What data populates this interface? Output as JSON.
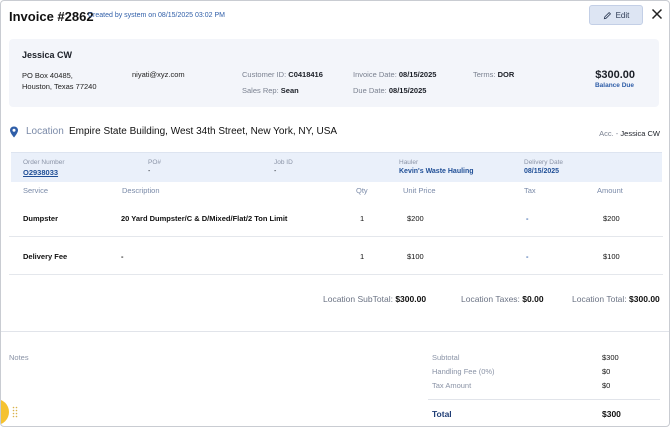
{
  "header": {
    "title": "Invoice #2862",
    "created": "Created by system on 08/15/2025 03:02 PM",
    "edit_label": "Edit"
  },
  "customer": {
    "name": "Jessica CW",
    "address_line1": "PO Box 40485,",
    "address_line2": "Houston, Texas 77240",
    "email": "niyati@xyz.com",
    "customer_id_label": "Customer ID:",
    "customer_id": "C0418416",
    "sales_rep_label": "Sales Rep:",
    "sales_rep": "Sean",
    "invoice_date_label": "Invoice Date:",
    "invoice_date": "08/15/2025",
    "due_date_label": "Due Date:",
    "due_date": "08/15/2025",
    "terms_label": "Terms:",
    "terms": "DOR",
    "balance_amount": "$300.00",
    "balance_label": "Balance Due"
  },
  "location": {
    "label": "Location",
    "value": "Empire State Building, West 34th Street, New York, NY, USA",
    "acc_label": "Acc. -",
    "acc_value": "Jessica CW"
  },
  "order": {
    "order_number_label": "Order Number",
    "order_number": "O2938033",
    "po_label": "PO#",
    "po_value": "-",
    "job_id_label": "Job ID",
    "job_id_value": "-",
    "hauler_label": "Hauler",
    "hauler_value": "Kevin's Waste Hauling",
    "delivery_date_label": "Delivery Date",
    "delivery_date_value": "08/15/2025"
  },
  "table": {
    "headers": [
      "Service",
      "Description",
      "Qty",
      "Unit Price",
      "Tax",
      "Amount"
    ],
    "rows": [
      {
        "service": "Dumpster",
        "description": "20 Yard Dumpster/C & D/Mixed/Flat/2 Ton Limit",
        "qty": "1",
        "unit_price": "$200",
        "tax": "-",
        "amount": "$200"
      },
      {
        "service": "Delivery Fee",
        "description": "-",
        "qty": "1",
        "unit_price": "$100",
        "tax": "-",
        "amount": "$100"
      }
    ]
  },
  "location_totals": {
    "subtotal_label": "Location SubTotal:",
    "subtotal": "$300.00",
    "taxes_label": "Location Taxes:",
    "taxes": "$0.00",
    "total_label": "Location Total:",
    "total": "$300.00"
  },
  "notes_label": "Notes",
  "summary": {
    "subtotal_label": "Subtotal",
    "subtotal": "$300",
    "handling_label": "Handling Fee (0%)",
    "handling": "$0",
    "tax_label": "Tax Amount",
    "tax": "$0",
    "total_label": "Total",
    "total": "$300"
  },
  "icons": {
    "edit": "pencil-icon",
    "close": "close-icon",
    "location": "map-pin-icon",
    "drag": "grip-dots-icon"
  },
  "colors": {
    "accent_blue": "#2f5ea8",
    "card_bg": "#f3f5fa",
    "order_bg": "#eaf0fa",
    "handle_yellow": "#f5c230"
  }
}
